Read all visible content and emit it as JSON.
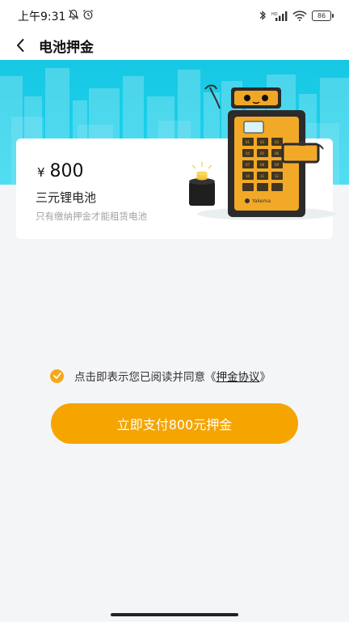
{
  "status_bar": {
    "time": "上午9:31",
    "battery": "86"
  },
  "nav": {
    "title": "电池押金"
  },
  "card": {
    "currency": "¥",
    "amount": "800",
    "battery_name": "三元锂电池",
    "hint": "只有缴纳押金才能租赁电池"
  },
  "illustration": {
    "brand": "Yakema"
  },
  "agreement": {
    "prefix": "点击即表示您已阅读并同意《",
    "link": "押金协议",
    "suffix": "》",
    "checked": true
  },
  "pay_button": {
    "label": "立即支付800元押金"
  },
  "colors": {
    "accent": "#f5a400",
    "banner": "#1fd3ee"
  }
}
